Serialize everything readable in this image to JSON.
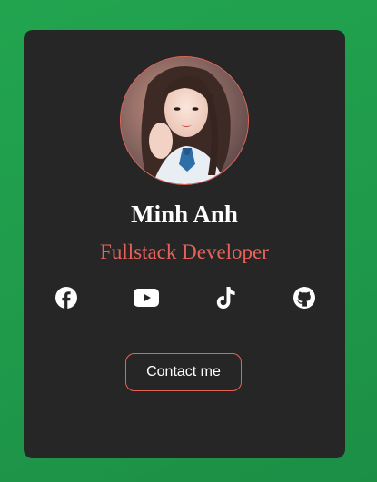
{
  "profile": {
    "name": "Minh Anh",
    "role": "Fullstack Developer"
  },
  "socials": [
    {
      "icon": "facebook-icon"
    },
    {
      "icon": "youtube-icon"
    },
    {
      "icon": "tiktok-icon"
    },
    {
      "icon": "github-icon"
    }
  ],
  "contact": {
    "label": "Contact me"
  },
  "colors": {
    "background": "#22a44f",
    "card": "#262626",
    "accent": "#e8625a",
    "text": "#ffffff"
  }
}
